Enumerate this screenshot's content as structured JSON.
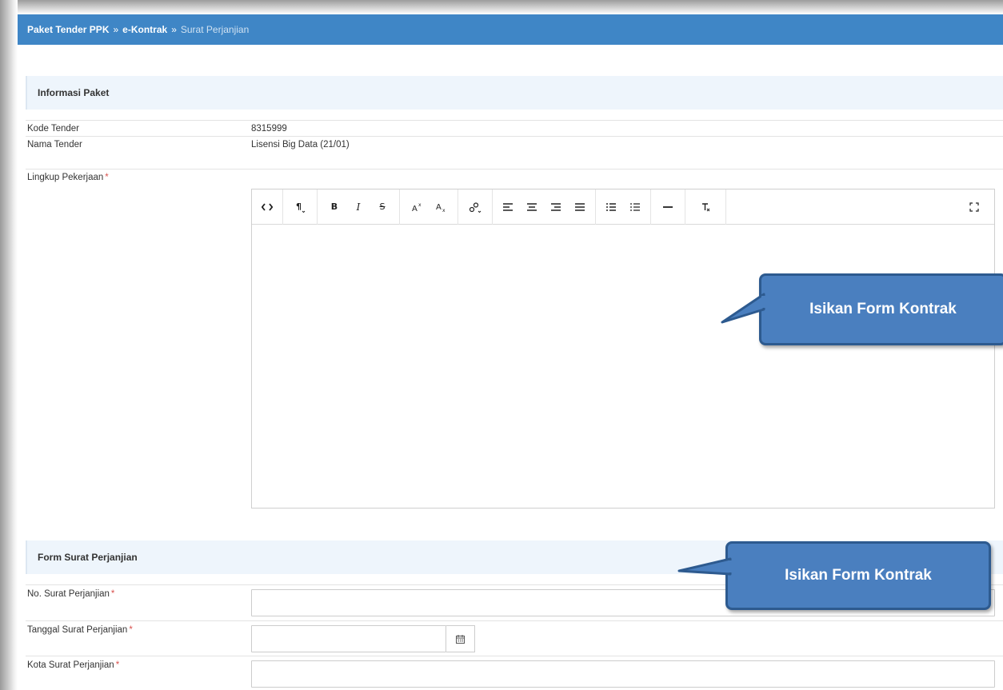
{
  "breadcrumb": {
    "items": [
      "Paket Tender PPK",
      "e-Kontrak"
    ],
    "separator": "»",
    "current": "Surat Perjanjian"
  },
  "info_section": {
    "title": "Informasi Paket",
    "kode_label": "Kode Tender",
    "kode_value": "8315999",
    "nama_label": "Nama Tender",
    "nama_value": "Lisensi Big Data (21/01)",
    "lingkup_label": "Lingkup Pekerjaan",
    "required_mark": "*"
  },
  "editor_toolbar": {
    "icons": [
      "code-view-icon",
      "paragraph-format-icon",
      "bold-icon",
      "italic-icon",
      "strikethrough-icon",
      "superscript-icon",
      "subscript-icon",
      "link-icon",
      "align-left-icon",
      "align-center-icon",
      "align-right-icon",
      "align-justify-icon",
      "bullet-list-icon",
      "numbered-list-icon",
      "horizontal-rule-icon",
      "clear-format-icon",
      "fullscreen-icon"
    ]
  },
  "form_section": {
    "title": "Form Surat Perjanjian",
    "no_label": "No. Surat Perjanjian",
    "tanggal_label": "Tanggal Surat Perjanjian",
    "kota_label": "Kota Surat Perjanjian",
    "no_value": "",
    "tanggal_value": "",
    "kota_value": ""
  },
  "callouts": {
    "first": "Isikan Form Kontrak",
    "second": "Isikan Form Kontrak",
    "color": "#4a7fbf",
    "border_color": "#2d5a8f"
  },
  "colors": {
    "header_bg": "#3f86c6",
    "section_bg": "#eef5fc",
    "required": "#d9534f"
  }
}
